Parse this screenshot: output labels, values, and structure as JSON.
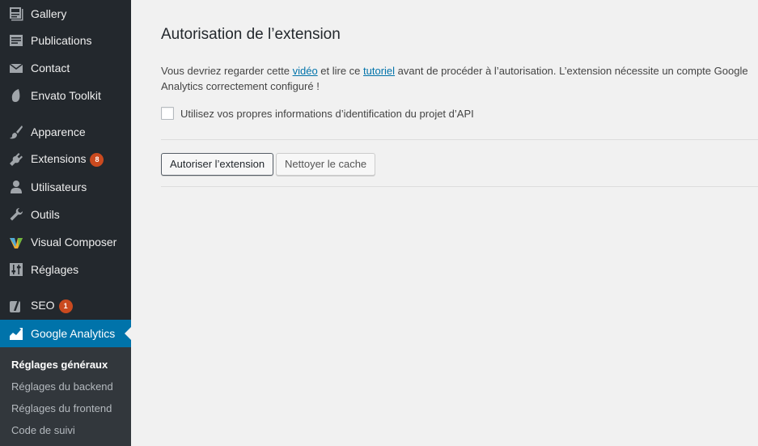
{
  "sidebar": {
    "items": [
      {
        "label": "Gallery",
        "icon": "gallery-icon"
      },
      {
        "label": "Publications",
        "icon": "publications-icon"
      },
      {
        "label": "Contact",
        "icon": "envelope-icon"
      },
      {
        "label": "Envato Toolkit",
        "icon": "leaf-icon"
      },
      {
        "label": "Apparence",
        "icon": "paintbrush-icon"
      },
      {
        "label": "Extensions",
        "icon": "plugin-icon",
        "badge": "8"
      },
      {
        "label": "Utilisateurs",
        "icon": "user-icon"
      },
      {
        "label": "Outils",
        "icon": "wrench-icon"
      },
      {
        "label": "Visual Composer",
        "icon": "visual-composer-icon"
      },
      {
        "label": "Réglages",
        "icon": "settings-sliders-icon"
      },
      {
        "label": "SEO",
        "icon": "yoast-icon",
        "badge": "1"
      },
      {
        "label": "Google Analytics",
        "icon": "analytics-icon",
        "active": true
      }
    ],
    "submenu": [
      {
        "label": "Réglages généraux",
        "current": true
      },
      {
        "label": "Réglages du backend"
      },
      {
        "label": "Réglages du frontend"
      },
      {
        "label": "Code de suivi"
      }
    ]
  },
  "main": {
    "title": "Autorisation de l’extension",
    "intro": {
      "before_video": "Vous devriez regarder cette ",
      "video_link": "vidéo",
      "between": " et lire ce ",
      "tutorial_link": "tutoriel",
      "after": " avant de procéder à l’autorisation. L’extension nécessite un compte Google Analytics correctement configuré !"
    },
    "checkbox_label": "Utilisez vos propres informations d’identification du projet d’API",
    "checkbox_checked": false,
    "authorize_button": "Autoriser l’extension",
    "clear_cache_button": "Nettoyer le cache"
  },
  "colors": {
    "sidebar_bg": "#23282d",
    "submenu_bg": "#32373c",
    "active_bg": "#0073aa",
    "badge_bg": "#ca4a1f",
    "link": "#0073aa",
    "content_bg": "#f1f1f1"
  }
}
